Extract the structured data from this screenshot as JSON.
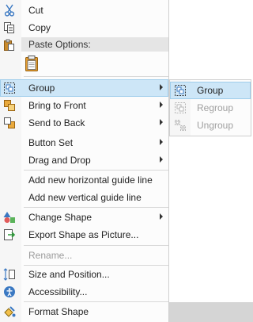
{
  "context_menu": {
    "cut": "Cut",
    "copy": "Copy",
    "paste_options_header": "Paste Options:",
    "group": "Group",
    "bring_to_front": "Bring to Front",
    "send_to_back": "Send to Back",
    "button_set": "Button Set",
    "drag_and_drop": "Drag and Drop",
    "add_horizontal_guide": "Add new horizontal guide line",
    "add_vertical_guide": "Add new vertical guide line",
    "change_shape": "Change Shape",
    "export_shape": "Export Shape as Picture...",
    "rename": "Rename...",
    "size_position": "Size and Position...",
    "accessibility": "Accessibility...",
    "format_shape": "Format Shape"
  },
  "group_submenu": {
    "group": "Group",
    "regroup": "Regroup",
    "ungroup": "Ungroup"
  },
  "icons": {
    "cut": "scissors-icon",
    "copy": "copy-icon",
    "paste": "paste-icon",
    "group": "group-icon",
    "bring_to_front": "bring-front-icon",
    "send_to_back": "send-back-icon",
    "change_shape": "shapes-icon",
    "export": "export-icon",
    "size_position": "size-position-icon",
    "accessibility": "accessibility-icon",
    "format_shape": "format-shape-icon"
  },
  "colors": {
    "highlight": "#cde6f7",
    "highlight_border": "#9fcdeb",
    "disabled_text": "#9a9a9a",
    "icon_blue": "#3a78c2"
  }
}
